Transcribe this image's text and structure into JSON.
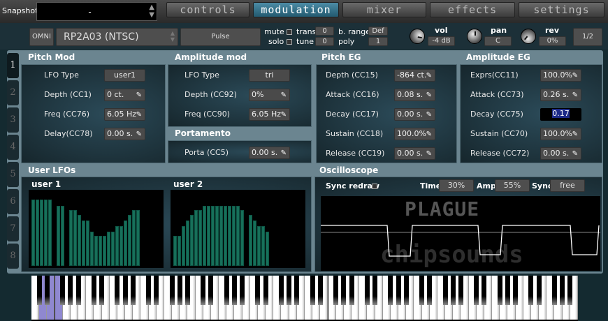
{
  "snapshot": {
    "label": "Snapshot",
    "value": "-"
  },
  "tabs": [
    {
      "label": "controls",
      "active": false
    },
    {
      "label": "modulation",
      "active": true
    },
    {
      "label": "mixer",
      "active": false
    },
    {
      "label": "effects",
      "active": false
    },
    {
      "label": "settings",
      "active": false
    }
  ],
  "instrument": {
    "omni": "OMNI",
    "preset": "RP2A03 (NTSC)",
    "wave": "Pulse",
    "mute": "mute",
    "solo": "solo",
    "trans_label": "trans",
    "trans": "0",
    "tune_label": "tune",
    "tune": "0",
    "brange_label": "b. range",
    "brange": "Def",
    "poly_label": "poly",
    "poly": "1",
    "vol_label": "vol",
    "vol": "-4 dB",
    "pan_label": "pan",
    "pan": "C",
    "rev_label": "rev",
    "rev": "0%",
    "page": "1/2"
  },
  "side_tabs": [
    "1",
    "2",
    "3",
    "4",
    "5",
    "6",
    "7",
    "8"
  ],
  "pitch_mod": {
    "title": "Pitch Mod",
    "rows": [
      {
        "label": "LFO Type",
        "value": "user1",
        "edit": false
      },
      {
        "label": "Depth (CC1)",
        "value": "0 ct.",
        "edit": true
      },
      {
        "label": "Freq (CC76)",
        "value": "6.05 Hz",
        "edit": true
      },
      {
        "label": "Delay(CC78)",
        "value": "0.00 s.",
        "edit": true
      }
    ]
  },
  "amp_mod": {
    "title": "Amplitude mod",
    "rows": [
      {
        "label": "LFO Type",
        "value": "tri",
        "edit": false
      },
      {
        "label": "Depth (CC92)",
        "value": "0%",
        "edit": true
      },
      {
        "label": "Freq (CC90)",
        "value": "6.05 Hz",
        "edit": true
      }
    ]
  },
  "portamento": {
    "title": "Portamento",
    "rows": [
      {
        "label": "Porta (CC5)",
        "value": "0.00 s.",
        "edit": true
      }
    ]
  },
  "pitch_eg": {
    "title": "Pitch EG",
    "rows": [
      {
        "label": "Depth (CC15)",
        "value": "-864 ct.",
        "edit": true
      },
      {
        "label": "Attack (CC16)",
        "value": "0.08 s.",
        "edit": true
      },
      {
        "label": "Decay (CC17)",
        "value": "0.00 s.",
        "edit": true
      },
      {
        "label": "Sustain (CC18)",
        "value": "100.0%",
        "edit": true
      },
      {
        "label": "Release (CC19)",
        "value": "0.00 s.",
        "edit": true
      }
    ]
  },
  "amp_eg": {
    "title": "Amplitude EG",
    "rows": [
      {
        "label": "Exprs(CC11)",
        "value": "100.0%",
        "edit": true
      },
      {
        "label": "Attack (CC73)",
        "value": "0.26 s.",
        "edit": true
      },
      {
        "label": "Decay (CC75)",
        "value": "0.17",
        "editing": true
      },
      {
        "label": "Sustain (CC70)",
        "value": "100.0%",
        "edit": true
      },
      {
        "label": "Release (CC72)",
        "value": "0.00 s.",
        "edit": true
      }
    ]
  },
  "user_lfos": {
    "title": "User LFOs",
    "user1": {
      "label": "user 1",
      "values": [
        0.85,
        0.85,
        0.85,
        0.85,
        0.85,
        0,
        0.77,
        0.77,
        0,
        0.71,
        0.71,
        0.65,
        0.58,
        0.58,
        0.44,
        0.38,
        0.38,
        0.38,
        0.44,
        0.44,
        0.51,
        0.51,
        0.58,
        0.65,
        0.71,
        0.71,
        0,
        0,
        0,
        0,
        0,
        0
      ]
    },
    "user2": {
      "label": "user 2",
      "values": [
        0.38,
        0.38,
        0.51,
        0.58,
        0.65,
        0.71,
        0.71,
        0.77,
        0.77,
        0.77,
        0.77,
        0.77,
        0.77,
        0.77,
        0.77,
        0.77,
        0.71,
        0,
        0.65,
        0.58,
        0.51,
        0.51,
        0.44,
        0,
        0,
        0,
        0,
        0,
        0,
        0,
        0,
        0
      ]
    }
  },
  "oscilloscope": {
    "title": "Oscilloscope",
    "sync_redraw": "Sync redraw",
    "time_label": "Time",
    "time": "30%",
    "amp_label": "Amp",
    "amp": "55%",
    "sync_label": "Sync",
    "sync": "free",
    "logo_top": "PLAGUE",
    "logo_bottom": "chipsounds"
  },
  "colors": {
    "accent": "#2f7a96",
    "bar": "#17705a",
    "pressed_key": "#8f88d0"
  },
  "keyboard": {
    "pressed_white_keys": [
      1,
      2,
      3
    ]
  }
}
